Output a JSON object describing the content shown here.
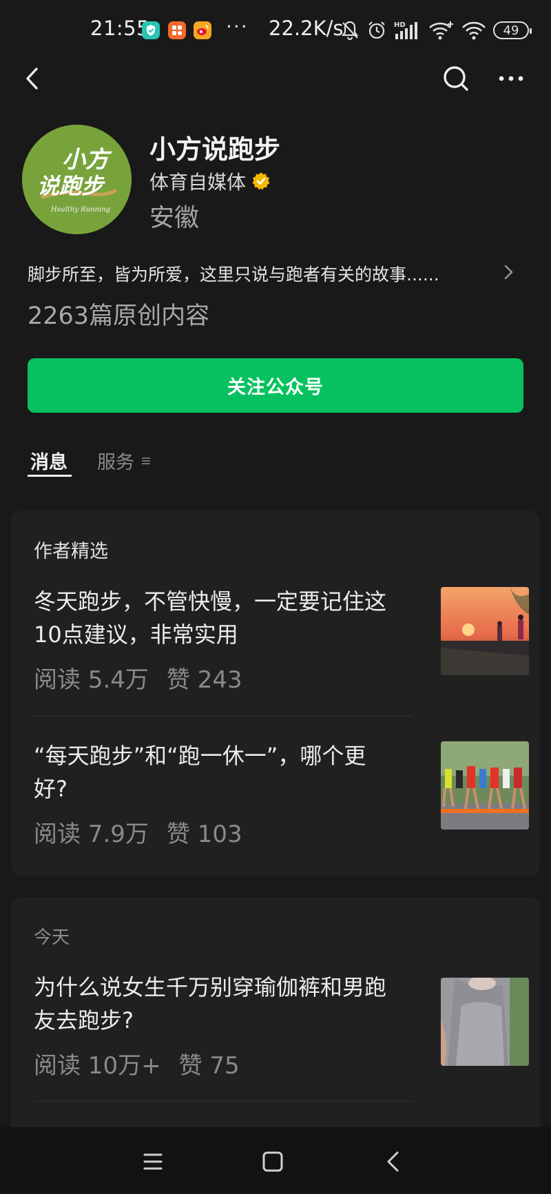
{
  "status_bar": {
    "time": "21:55",
    "dots": "···",
    "network_speed": "22.2K/s",
    "battery": "49",
    "icons": [
      "shield-app-icon",
      "photo-app-icon",
      "weibo-icon",
      "mute-bell-icon",
      "alarm-icon",
      "hd-signal-icon",
      "wifi-plus-icon",
      "wifi-icon",
      "battery-icon"
    ]
  },
  "top_bar": {
    "icons": [
      "back-arrow-icon",
      "search-icon",
      "more-dots-icon"
    ]
  },
  "profile": {
    "avatar_text_line1": "小方",
    "avatar_text_line2": "说跑步",
    "avatar_tagline": "Healthy Running",
    "name": "小方说跑步",
    "category": "体育自媒体",
    "region": "安徽",
    "bio": "脚步所至，皆为所爱，这里只说与跑者有关的故事......",
    "original_count": "2263篇原创内容",
    "follow_label": "关注公众号"
  },
  "tabs": [
    {
      "label": "消息",
      "active": true
    },
    {
      "label": "服务",
      "active": false
    }
  ],
  "featured": {
    "label": "作者精选",
    "articles": [
      {
        "title": "冬天跑步，不管快慢，一定要记住这10点建议，非常实用",
        "reads": "阅读 5.4万",
        "likes": "赞 243"
      },
      {
        "title": "“每天跑步”和“跑一休一”，哪个更好?",
        "reads": "阅读 7.9万",
        "likes": "赞 103"
      }
    ]
  },
  "today": {
    "label": "今天",
    "articles": [
      {
        "title": "为什么说女生千万别穿瑜伽裤和男跑友去跑步?",
        "reads": "阅读 10万+",
        "likes": "赞 75"
      }
    ]
  },
  "colors": {
    "background": "#191919",
    "card": "#202020",
    "accent_green": "#07c160",
    "verified_gold": "#f5b800"
  },
  "nav_bar": {
    "icons": [
      "menu-icon",
      "home-square-icon",
      "nav-back-icon"
    ]
  }
}
